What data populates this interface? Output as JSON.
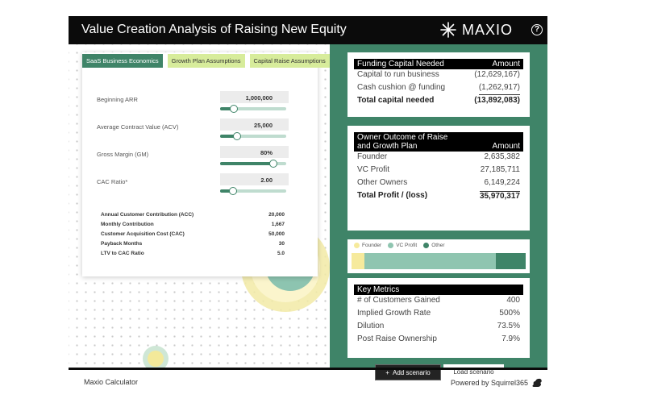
{
  "header": {
    "title": "Value Creation Analysis of Raising New Equity",
    "logo_text": "MAXIO",
    "help_glyph": "?"
  },
  "tabs": [
    {
      "label": "SaaS Business Economics",
      "active": true
    },
    {
      "label": "Growth Plan Assumptions",
      "active": false
    },
    {
      "label": "Capital Raise Assumptions",
      "active": false
    }
  ],
  "inputs": [
    {
      "label": "Beginning ARR",
      "value": "1,000,000",
      "slider_fraction": 0.21
    },
    {
      "label": "Average Contract Value (ACV)",
      "value": "25,000",
      "slider_fraction": 0.25
    },
    {
      "label": "Gross Margin (GM)",
      "value": "80%",
      "slider_fraction": 0.8
    },
    {
      "label": "CAC Ratio*",
      "value": "2.00",
      "slider_fraction": 0.2
    }
  ],
  "summary": [
    {
      "label": "Annual Customer Contribution (ACC)",
      "value": "20,000"
    },
    {
      "label": "Monthly Contribution",
      "value": "1,667"
    },
    {
      "label": "Customer Acquisition Cost (CAC)",
      "value": "50,000"
    },
    {
      "label": "Payback Months",
      "value": "30"
    },
    {
      "label": "LTV to CAC Ratio",
      "value": "5.0"
    }
  ],
  "funding": {
    "header": "Funding Capital Needed",
    "amount_header": "Amount",
    "rows": [
      {
        "label": "Capital to run business",
        "value": "(12,629,167)"
      },
      {
        "label": "Cash cushion @ funding",
        "value": "(1,262,917)"
      }
    ],
    "total": {
      "label": "Total capital needed",
      "value": "(13,892,083)"
    }
  },
  "owner": {
    "header_line1": "Owner Outcome of Raise",
    "header_line2": "and Growth Plan",
    "amount_header": "Amount",
    "rows": [
      {
        "label": "Founder",
        "value": "2,635,382"
      },
      {
        "label": "VC Profit",
        "value": "27,185,711"
      },
      {
        "label": "Other Owners",
        "value": "6,149,224"
      }
    ],
    "total": {
      "label": "Total Profit / (loss)",
      "value": "35,970,317"
    }
  },
  "profit_chart": {
    "legend": [
      {
        "name": "Founder",
        "color": "#f6ea9c"
      },
      {
        "name": "VC Profit",
        "color": "#8fc5b0"
      },
      {
        "name": "Other",
        "color": "#3f8468"
      }
    ],
    "values": [
      2635382,
      27185711,
      6149224
    ]
  },
  "metrics": {
    "header": "Key Metrics",
    "rows": [
      {
        "label": "# of Customers Gained",
        "value": "400"
      },
      {
        "label": "Implied Growth Rate",
        "value": "500%"
      },
      {
        "label": "Dilution",
        "value": "73.5%"
      },
      {
        "label": "Post Raise Ownership",
        "value": "7.9%"
      }
    ]
  },
  "buttons": {
    "add_glyph": "+",
    "add_label": "Add scenario",
    "load_label": "Load scenario"
  },
  "footer": {
    "left": "Maxio Calculator",
    "right": "Powered by Squirrel365"
  },
  "colors": {
    "brand_green": "#3f8468",
    "tab_inactive": "#d7ec9b",
    "topbar": "#0b0b0b"
  }
}
